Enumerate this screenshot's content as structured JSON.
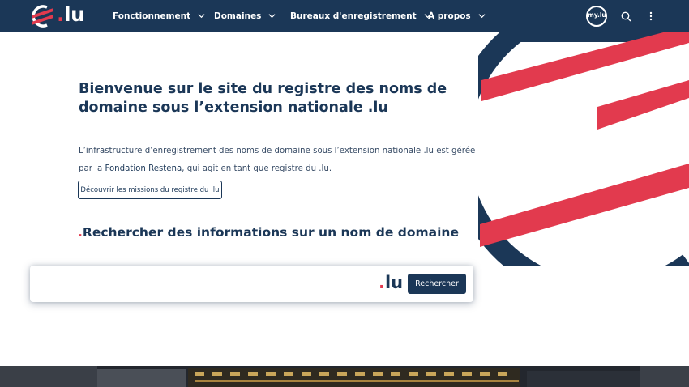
{
  "header": {
    "logo_text": ".lu",
    "nav": [
      {
        "label": "Fonctionnement"
      },
      {
        "label": "Domaines"
      },
      {
        "label": "Bureaux d'enregistrement"
      },
      {
        "label": "À propos"
      }
    ],
    "mylu_label": "my.lu",
    "icons": [
      "mylu-icon",
      "search-icon",
      "more-vertical-icon"
    ]
  },
  "hero": {
    "title": "Bienvenue sur le site du registre des noms de domaine sous l’extension nationale .lu",
    "intro_before": "L’infrastructure d’enregistrement des noms de domaine sous l’extension nationale .lu est gérée par la ",
    "intro_link": "Fondation Restena",
    "intro_after": ", qui agit en tant que registre du .lu.",
    "cta_label": "Découvrir les missions du registre du .lu"
  },
  "search": {
    "title_dot": ".",
    "title": "Rechercher des informations sur un nom de domaine",
    "input_value": "",
    "input_placeholder": "",
    "suffix": "lu",
    "suffix_dot": ".",
    "button_label": "Rechercher"
  },
  "colors": {
    "navy": "#1b3757",
    "red": "#e23a4e",
    "white": "#ffffff"
  }
}
